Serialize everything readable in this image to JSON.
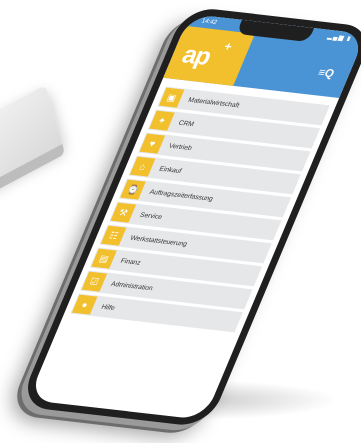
{
  "app": {
    "logo": "ap",
    "logo_plus": "+"
  },
  "status_bar": {
    "time": "14:42",
    "icons": "▂▄▆ ▮"
  },
  "header": {
    "menu_icon": "menu-search-icon",
    "menu_glyph": "≡Q"
  },
  "colors": {
    "header_blue": "#4a93d4",
    "logo_yellow": "#f2bf2d",
    "item_gray": "#e6e7e9",
    "phone_black": "#1f1f1f"
  },
  "menu": {
    "items": [
      {
        "label": "Materialwirtschaft",
        "icon": "forklift-icon",
        "glyph": "▣"
      },
      {
        "label": "CRM",
        "icon": "handshake-icon",
        "glyph": "✦"
      },
      {
        "label": "Vertrieb",
        "icon": "sales-icon",
        "glyph": "♥"
      },
      {
        "label": "Einkauf",
        "icon": "cart-icon",
        "glyph": "⌂"
      },
      {
        "label": "Auftragszeiterfassung",
        "icon": "time-tracking-icon",
        "glyph": "⌚"
      },
      {
        "label": "Service",
        "icon": "service-icon",
        "glyph": "⚒"
      },
      {
        "label": "Werkstattsteuerung",
        "icon": "workshop-icon",
        "glyph": "☷"
      },
      {
        "label": "Finanz",
        "icon": "finance-icon",
        "glyph": "▤"
      },
      {
        "label": "Administration",
        "icon": "admin-icon",
        "glyph": "☑"
      },
      {
        "label": "Hilfe",
        "icon": "help-icon",
        "glyph": "●"
      }
    ]
  }
}
